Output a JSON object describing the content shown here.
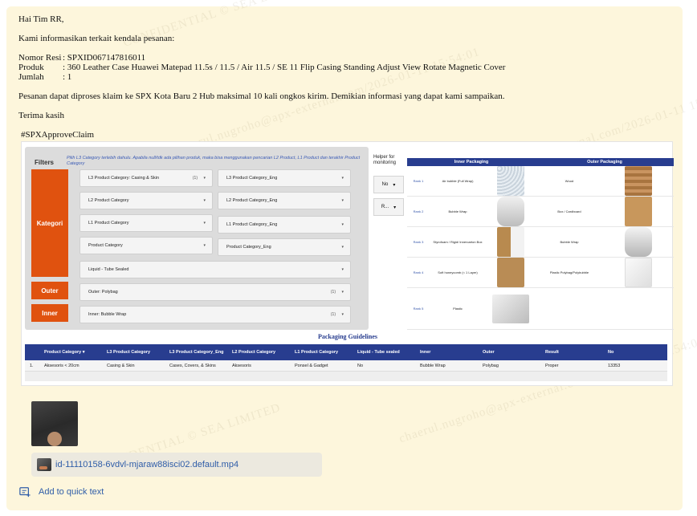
{
  "message": {
    "greeting": "Hai Tim RR,",
    "intro": "Kami informasikan terkait kendala pesanan:",
    "fields": [
      {
        "label": "Nomor Resi",
        "value": ": SPXID067147816011"
      },
      {
        "label": "Produk",
        "value": ": 360 Leather Case Huawei Matepad 11.5s / 11.5 / Air 11.5 / SE 11 Flip Casing Standing Adjust View Rotate Magnetic Cover"
      },
      {
        "label": "Jumlah",
        "value": ": 1"
      }
    ],
    "body": "Pesanan dapat diproses klaim ke SPX Kota Baru 2 Hub maksimal 10 kali ongkos kirim. Demikian informasi yang dapat kami sampaikan.",
    "closing": "Terima kasih",
    "tag": "#SPXApproveClaim"
  },
  "embedded": {
    "filters_title": "Filters",
    "filters_note": "Pilih L3 Category terlebih dahulu. Apabila null/tdk ada pilihan produk, maka bisa menggunakan pencarian L2 Product, L1 Product dan terakhir Product Category",
    "categories": {
      "kategori": "Kategori",
      "outer": "Outer",
      "inner": "Inner"
    },
    "dropdowns": {
      "l3": "L3 Product Category: Casing & Skin",
      "l3_count": "(1)",
      "l3_eng": "L3 Product Category_Eng",
      "l2": "L2 Product Category",
      "l2_eng": "L2 Product Category_Eng",
      "l1": "L1 Product Category",
      "l1_eng": "L1 Product Category_Eng",
      "pc": "Product Category",
      "pc_eng": "Product Category_Eng",
      "liquid": "Liquid - Tube Sealed",
      "outer": "Outer: Polybag",
      "outer_count": "(1)",
      "inner": "Inner: Bubble Wrap",
      "inner_count": "(1)"
    },
    "helper_title": "Helper for monitoring",
    "helper_buttons": [
      "No",
      "R..."
    ],
    "packaging": {
      "inner_header": "Inner Packaging",
      "outer_header": "Outer Packaging",
      "rows": [
        {
          "rank": "Rank 1",
          "inner": "Air bubble (Full Wrap)",
          "outer": "Wood"
        },
        {
          "rank": "Rank 2",
          "inner": "Bubble Wrap",
          "outer": "Box / Cardboard"
        },
        {
          "rank": "Rank 3",
          "inner": "Styrofoam / Rigid/ Innercarton Box",
          "outer": "Bubble Wrap"
        },
        {
          "rank": "Rank 4",
          "inner": "Soft honeycomb (< 1 Layer)",
          "outer": "Plastic Polybag/Polybubble"
        },
        {
          "rank": "Rank 5",
          "inner": "Plastic",
          "outer": ""
        }
      ]
    },
    "guidelines_title": "Packaging Guidelines",
    "table": {
      "headers": [
        "",
        "Product Category",
        "L3 Product Category",
        "L3 Product Category_Eng",
        "L2 Product Category",
        "L1 Product Category",
        "Liquid - Tube sealed",
        "Inner",
        "Outer",
        "Result",
        "No"
      ],
      "rows": [
        [
          "1.",
          "Aksesoris < 20cm",
          "Casing & Skin",
          "Cases, Covers, & Skins",
          "Aksesoris",
          "Ponsel & Gadget",
          "No",
          "Bubble Wrap",
          "Polybag",
          "Proper",
          "13353"
        ]
      ]
    }
  },
  "attachment": {
    "filename": "id-11110158-6vdvl-mjaraw88isci02.default.mp4"
  },
  "quick_text_label": "Add to quick text",
  "colors": {
    "card_bg": "#fdf6dc",
    "accent_orange": "#e0520f",
    "navy": "#283d8f",
    "link_blue": "#2f5da8"
  }
}
